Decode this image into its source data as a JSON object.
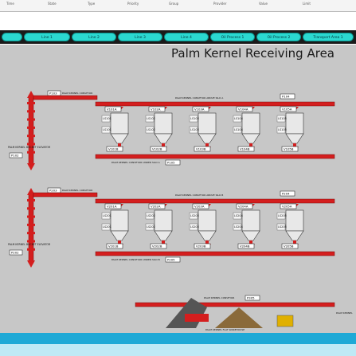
{
  "header": {
    "columns": [
      "Time",
      "State",
      "Type",
      "Priority",
      "Group",
      "Provider",
      "Value",
      "Limit"
    ]
  },
  "tabs": [
    "Line 1",
    "Line 2",
    "Line 3",
    "Line 4",
    "Oil Process 1",
    "Oil Process 2",
    "Transport Area 1"
  ],
  "title": "Palm Kernel Receiving Area",
  "section1": {
    "elevator": "P103",
    "elevator_label": "PALM KERNEL CONVEYOR",
    "above_label": "PALM KERNEL CONVEYOR ABOVE SILO A",
    "above_id": "P104",
    "valves": [
      "V101A",
      "V102A",
      "V103A",
      "V104A",
      "V105A"
    ],
    "silos_top": [
      "LS101",
      "LS102",
      "LS103",
      "LS104",
      "LS105"
    ],
    "silos_bot": [
      "LS101",
      "LS102",
      "LS103",
      "LS104",
      "LS105"
    ],
    "valves_bottom": [
      "V101B",
      "V102B",
      "V103B",
      "V104B",
      "V105B"
    ],
    "under_label": "PALM KERNEL CONVEYOR UNDER SILO A",
    "under_id": "P105",
    "bucket_label": "PALM KERNEL BUCKET ELEVATOR",
    "bucket_id": "P102"
  },
  "section2": {
    "elevator": "P203",
    "elevator_label": "PALM KERNEL CONVEYOR",
    "above_label": "PALM KERNEL CONVEYOR ABOVE SILO B",
    "above_id": "P204",
    "valves": [
      "V201A",
      "V202A",
      "V203A",
      "V204A",
      "V205A"
    ],
    "silos_top": [
      "LS201",
      "LS202",
      "LS203",
      "LS204",
      "LS205"
    ],
    "silos_bot": [
      "LS201",
      "LS202",
      "LS203",
      "LS204",
      "LS205"
    ],
    "valves_bottom": [
      "V201B",
      "V202B",
      "V203B",
      "V204B",
      "V205B"
    ],
    "under_label": "PALM KERNEL CONVEYOR UNDER SILO B",
    "under_id": "P205",
    "bucket_label": "PALM KERNEL BUCKET ELEVATOR",
    "bucket_id": "P202"
  },
  "section3": {
    "conveyor_label": "PALM KERNEL CONVEYOR",
    "conveyor_id": "P305",
    "warehouse_label": "PALM KERNEL FLAT WAREHOUSE",
    "side_label": "PALM KERNEL"
  },
  "colors": {
    "tab": "#2bd8d0",
    "accent_red": "#d41e1e",
    "bg": "#c7c7c7",
    "bottom": "#1fa9d6"
  }
}
